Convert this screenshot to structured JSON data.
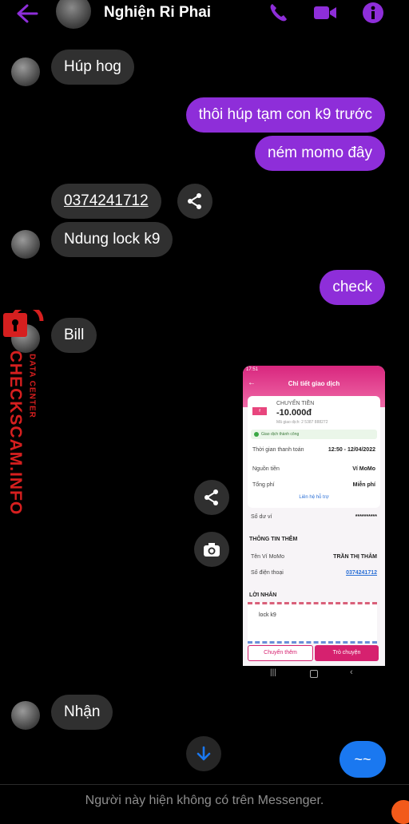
{
  "header": {
    "contact_name": "Nghiện Ri Phai"
  },
  "messages": [
    {
      "side": "in",
      "text": "Húp hog"
    },
    {
      "side": "out",
      "text": "thôi húp tạm con k9 trước"
    },
    {
      "side": "out",
      "text": "ném momo đây"
    },
    {
      "side": "in",
      "text": "0374241712"
    },
    {
      "side": "in",
      "text": "Ndung lock k9"
    },
    {
      "side": "out",
      "text": "check"
    },
    {
      "side": "in",
      "text": "Bill"
    },
    {
      "side": "in",
      "text": "Nhận"
    }
  ],
  "shot": {
    "status_time": "17:51",
    "title": "Chi tiết giao dịch",
    "type": "CHUYỂN TIỀN",
    "amount": "-10.000đ",
    "txn_code": "Mã giao dịch: 2 5387 888272",
    "status": "Giao dịch thành công",
    "time_label": "Thời gian thanh toán",
    "time_value": "12:50 - 12/04/2022",
    "source_label": "Nguồn tiền",
    "source_value": "Ví MoMo",
    "fee_label": "Tổng phí",
    "fee_value": "Miễn phí",
    "support": "Liên hệ hỗ trợ",
    "balance_label": "Số dư ví",
    "balance_value": "**********",
    "section": "THÔNG TIN THÊM",
    "wallet_label": "Tên Ví MoMo",
    "wallet_value": "TRẦN THỊ THẮM",
    "phone_label": "Số điện thoại",
    "phone_value": "0374241712",
    "note_section": "LỜI NHẮN",
    "note": "lock k9",
    "btn_more": "Chuyển thêm",
    "btn_chat": "Trò chuyện"
  },
  "watermark": {
    "brand": "CHECKSCAM.INFO",
    "sub": "DATA CENTER"
  },
  "typing": "~~",
  "footer": "Người này hiện không có trên Messenger.",
  "colors": {
    "accent": "#8e2ed9",
    "bubble_in": "#303030",
    "send_blue": "#1a78f0"
  }
}
